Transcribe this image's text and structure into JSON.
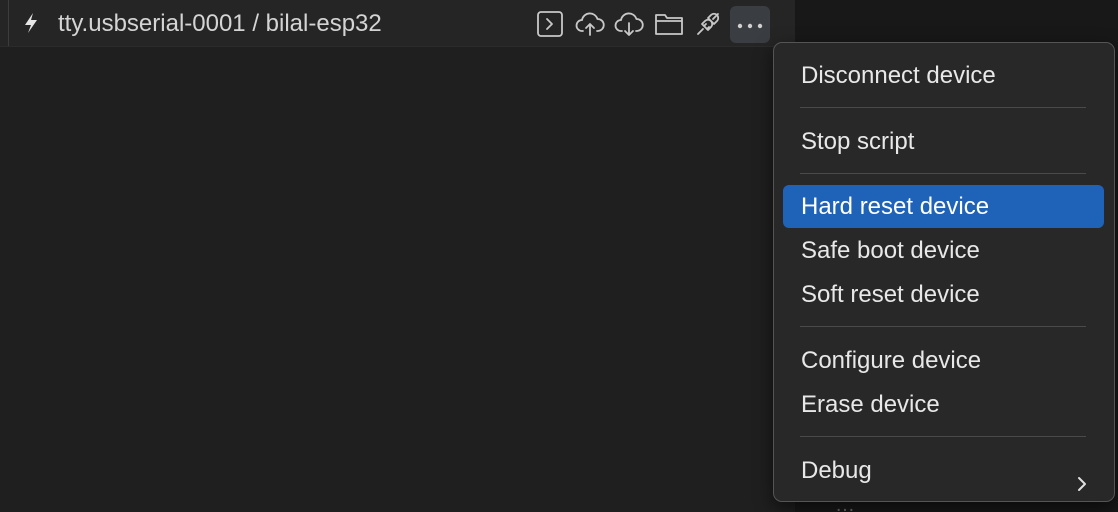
{
  "titlebar": {
    "title": "tty.usbserial-0001 / bilal-esp32",
    "icons": [
      "lightning-bolt-icon",
      "terminal-icon",
      "cloud-upload-icon",
      "cloud-download-icon",
      "folder-icon",
      "plug-icon",
      "more-icon"
    ]
  },
  "menu": {
    "disconnect": "Disconnect device",
    "stop_script": "Stop script",
    "hard_reset": "Hard reset device",
    "safe_boot": "Safe boot device",
    "soft_reset": "Soft reset device",
    "configure": "Configure device",
    "erase": "Erase device",
    "debug": "Debug"
  },
  "background": {
    "peek_text": "…"
  },
  "colors": {
    "highlight": "#1f63b8",
    "menu_bg": "#282828",
    "editor_bg": "#1f1f1f"
  }
}
